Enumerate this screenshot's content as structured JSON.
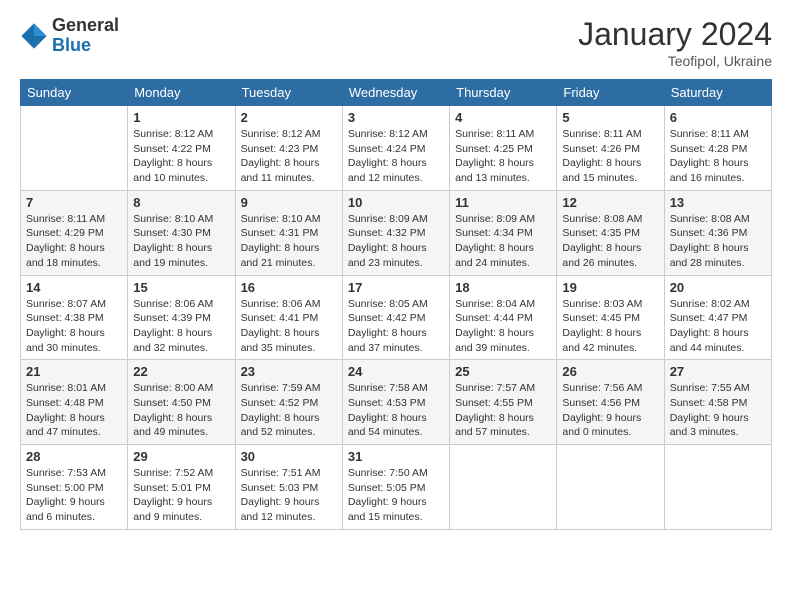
{
  "logo": {
    "general": "General",
    "blue": "Blue"
  },
  "title": "January 2024",
  "location": "Teofipol, Ukraine",
  "days_of_week": [
    "Sunday",
    "Monday",
    "Tuesday",
    "Wednesday",
    "Thursday",
    "Friday",
    "Saturday"
  ],
  "weeks": [
    [
      {
        "day": "",
        "info": ""
      },
      {
        "day": "1",
        "info": "Sunrise: 8:12 AM\nSunset: 4:22 PM\nDaylight: 8 hours\nand 10 minutes."
      },
      {
        "day": "2",
        "info": "Sunrise: 8:12 AM\nSunset: 4:23 PM\nDaylight: 8 hours\nand 11 minutes."
      },
      {
        "day": "3",
        "info": "Sunrise: 8:12 AM\nSunset: 4:24 PM\nDaylight: 8 hours\nand 12 minutes."
      },
      {
        "day": "4",
        "info": "Sunrise: 8:11 AM\nSunset: 4:25 PM\nDaylight: 8 hours\nand 13 minutes."
      },
      {
        "day": "5",
        "info": "Sunrise: 8:11 AM\nSunset: 4:26 PM\nDaylight: 8 hours\nand 15 minutes."
      },
      {
        "day": "6",
        "info": "Sunrise: 8:11 AM\nSunset: 4:28 PM\nDaylight: 8 hours\nand 16 minutes."
      }
    ],
    [
      {
        "day": "7",
        "info": "Sunrise: 8:11 AM\nSunset: 4:29 PM\nDaylight: 8 hours\nand 18 minutes."
      },
      {
        "day": "8",
        "info": "Sunrise: 8:10 AM\nSunset: 4:30 PM\nDaylight: 8 hours\nand 19 minutes."
      },
      {
        "day": "9",
        "info": "Sunrise: 8:10 AM\nSunset: 4:31 PM\nDaylight: 8 hours\nand 21 minutes."
      },
      {
        "day": "10",
        "info": "Sunrise: 8:09 AM\nSunset: 4:32 PM\nDaylight: 8 hours\nand 23 minutes."
      },
      {
        "day": "11",
        "info": "Sunrise: 8:09 AM\nSunset: 4:34 PM\nDaylight: 8 hours\nand 24 minutes."
      },
      {
        "day": "12",
        "info": "Sunrise: 8:08 AM\nSunset: 4:35 PM\nDaylight: 8 hours\nand 26 minutes."
      },
      {
        "day": "13",
        "info": "Sunrise: 8:08 AM\nSunset: 4:36 PM\nDaylight: 8 hours\nand 28 minutes."
      }
    ],
    [
      {
        "day": "14",
        "info": "Sunrise: 8:07 AM\nSunset: 4:38 PM\nDaylight: 8 hours\nand 30 minutes."
      },
      {
        "day": "15",
        "info": "Sunrise: 8:06 AM\nSunset: 4:39 PM\nDaylight: 8 hours\nand 32 minutes."
      },
      {
        "day": "16",
        "info": "Sunrise: 8:06 AM\nSunset: 4:41 PM\nDaylight: 8 hours\nand 35 minutes."
      },
      {
        "day": "17",
        "info": "Sunrise: 8:05 AM\nSunset: 4:42 PM\nDaylight: 8 hours\nand 37 minutes."
      },
      {
        "day": "18",
        "info": "Sunrise: 8:04 AM\nSunset: 4:44 PM\nDaylight: 8 hours\nand 39 minutes."
      },
      {
        "day": "19",
        "info": "Sunrise: 8:03 AM\nSunset: 4:45 PM\nDaylight: 8 hours\nand 42 minutes."
      },
      {
        "day": "20",
        "info": "Sunrise: 8:02 AM\nSunset: 4:47 PM\nDaylight: 8 hours\nand 44 minutes."
      }
    ],
    [
      {
        "day": "21",
        "info": "Sunrise: 8:01 AM\nSunset: 4:48 PM\nDaylight: 8 hours\nand 47 minutes."
      },
      {
        "day": "22",
        "info": "Sunrise: 8:00 AM\nSunset: 4:50 PM\nDaylight: 8 hours\nand 49 minutes."
      },
      {
        "day": "23",
        "info": "Sunrise: 7:59 AM\nSunset: 4:52 PM\nDaylight: 8 hours\nand 52 minutes."
      },
      {
        "day": "24",
        "info": "Sunrise: 7:58 AM\nSunset: 4:53 PM\nDaylight: 8 hours\nand 54 minutes."
      },
      {
        "day": "25",
        "info": "Sunrise: 7:57 AM\nSunset: 4:55 PM\nDaylight: 8 hours\nand 57 minutes."
      },
      {
        "day": "26",
        "info": "Sunrise: 7:56 AM\nSunset: 4:56 PM\nDaylight: 9 hours\nand 0 minutes."
      },
      {
        "day": "27",
        "info": "Sunrise: 7:55 AM\nSunset: 4:58 PM\nDaylight: 9 hours\nand 3 minutes."
      }
    ],
    [
      {
        "day": "28",
        "info": "Sunrise: 7:53 AM\nSunset: 5:00 PM\nDaylight: 9 hours\nand 6 minutes."
      },
      {
        "day": "29",
        "info": "Sunrise: 7:52 AM\nSunset: 5:01 PM\nDaylight: 9 hours\nand 9 minutes."
      },
      {
        "day": "30",
        "info": "Sunrise: 7:51 AM\nSunset: 5:03 PM\nDaylight: 9 hours\nand 12 minutes."
      },
      {
        "day": "31",
        "info": "Sunrise: 7:50 AM\nSunset: 5:05 PM\nDaylight: 9 hours\nand 15 minutes."
      },
      {
        "day": "",
        "info": ""
      },
      {
        "day": "",
        "info": ""
      },
      {
        "day": "",
        "info": ""
      }
    ]
  ]
}
